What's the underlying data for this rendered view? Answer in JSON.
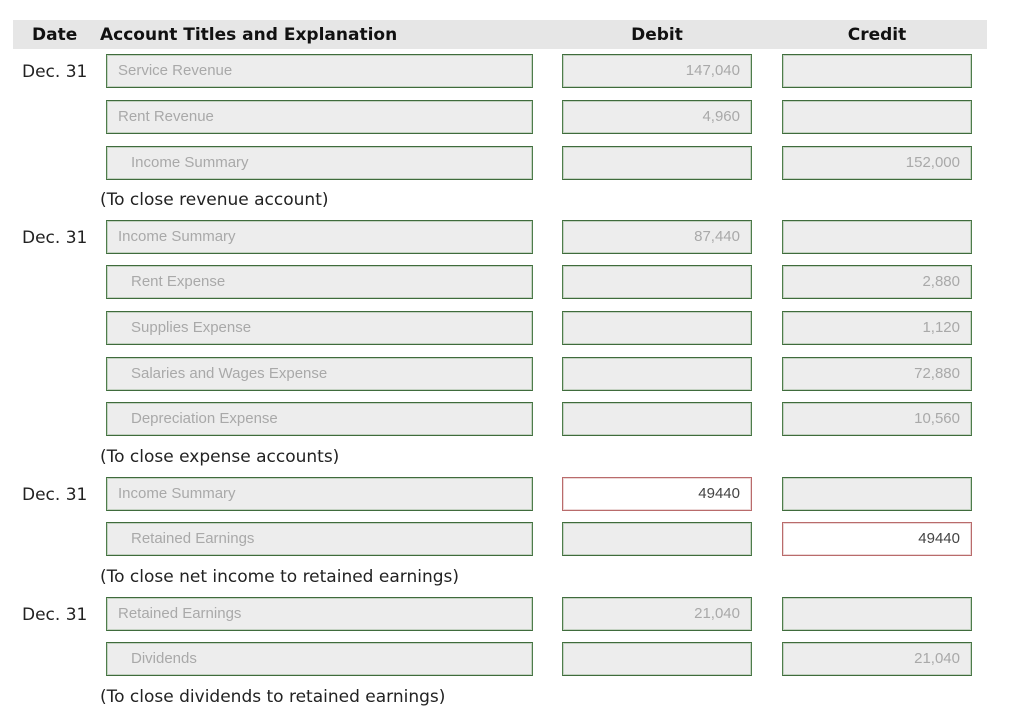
{
  "header": {
    "date": "Date",
    "account": "Account Titles and Explanation",
    "debit": "Debit",
    "credit": "Credit"
  },
  "entries": [
    {
      "date": "Dec. 31",
      "lines": [
        {
          "account": "Service Revenue",
          "indent": false,
          "debit": "147,040",
          "credit": ""
        },
        {
          "account": "Rent Revenue",
          "indent": false,
          "debit": "4,960",
          "credit": ""
        },
        {
          "account": "Income Summary",
          "indent": true,
          "debit": "",
          "credit": "152,000"
        }
      ],
      "explanation": "(To close revenue account)"
    },
    {
      "date": "Dec. 31",
      "lines": [
        {
          "account": "Income Summary",
          "indent": false,
          "debit": "87,440",
          "credit": ""
        },
        {
          "account": "Rent Expense",
          "indent": true,
          "debit": "",
          "credit": "2,880"
        },
        {
          "account": "Supplies Expense",
          "indent": true,
          "debit": "",
          "credit": "1,120"
        },
        {
          "account": "Salaries and Wages Expense",
          "indent": true,
          "debit": "",
          "credit": "72,880"
        },
        {
          "account": "Depreciation Expense",
          "indent": true,
          "debit": "",
          "credit": "10,560"
        }
      ],
      "explanation": "(To close expense accounts)"
    },
    {
      "date": "Dec. 31",
      "lines": [
        {
          "account": "Income Summary",
          "indent": false,
          "debit": "49440",
          "credit": "",
          "debit_error": true
        },
        {
          "account": "Retained Earnings",
          "indent": true,
          "debit": "",
          "credit": "49440",
          "credit_error": true
        }
      ],
      "explanation": "(To close net income to retained earnings)"
    },
    {
      "date": "Dec. 31",
      "lines": [
        {
          "account": "Retained Earnings",
          "indent": false,
          "debit": "21,040",
          "credit": ""
        },
        {
          "account": "Dividends",
          "indent": true,
          "debit": "",
          "credit": "21,040"
        }
      ],
      "explanation": "(To close dividends to retained earnings)"
    }
  ],
  "colors": {
    "valid_border": "#4e7d4b",
    "error_border": "#b96b6b",
    "input_bg": "#ededed",
    "header_bg": "#e6e6e6"
  }
}
